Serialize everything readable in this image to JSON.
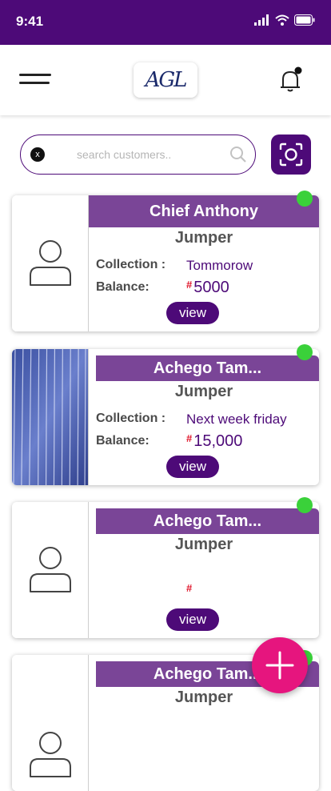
{
  "status": {
    "time": "9:41"
  },
  "header": {
    "logo_text": "AGL",
    "menu_icon": "hamburger-icon",
    "notification_icon": "bell-icon"
  },
  "search": {
    "placeholder": "search customers..",
    "clear_label": "x"
  },
  "customers": [
    {
      "name": "Chief Anthony",
      "item": "Jumper",
      "collection_label": "Collection :",
      "collection": "Tommorow",
      "balance_label": "Balance:",
      "currency": "#",
      "balance": "5000",
      "view_label": "view",
      "has_photo": false
    },
    {
      "name": "Achego Tam...",
      "item": "Jumper",
      "collection_label": "Collection :",
      "collection": "Next week friday",
      "balance_label": "Balance:",
      "currency": "#",
      "balance": "15,000",
      "view_label": "view",
      "has_photo": true
    },
    {
      "name": "Achego Tam...",
      "item": "Jumper",
      "currency": "#",
      "view_label": "view",
      "has_photo": false
    },
    {
      "name": "Achego Tam...",
      "item": "Jumper",
      "has_photo": false
    }
  ],
  "colors": {
    "primary": "#4d0a78",
    "name_bar": "#7a4597",
    "online": "#3ad13a",
    "fab": "#e6157e",
    "currency": "#e0162b"
  }
}
